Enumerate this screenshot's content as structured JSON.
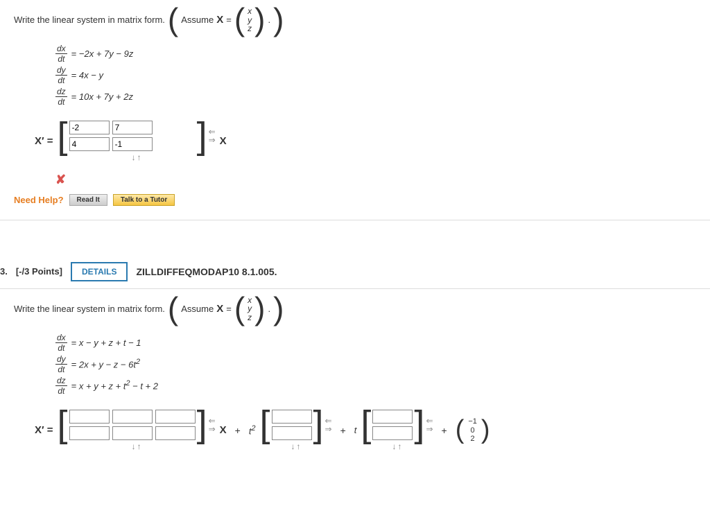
{
  "q2": {
    "prompt_a": "Write the linear system in matrix form.",
    "assume_label": "Assume",
    "assume_var": "X",
    "equals": "=",
    "vec": {
      "r1": "x",
      "r2": "y",
      "r3": "z"
    },
    "period": ".",
    "eqs": {
      "e1": {
        "lhs_num": "dx",
        "lhs_den": "dt",
        "eq": "=",
        "rhs": "−2x + 7y − 9z"
      },
      "e2": {
        "lhs_num": "dy",
        "lhs_den": "dt",
        "eq": "=",
        "rhs": "4x − y"
      },
      "e3": {
        "lhs_num": "dz",
        "lhs_den": "dt",
        "eq": "=",
        "rhs": "10x + 7y + 2z"
      }
    },
    "xprime": "X′",
    "matrix": {
      "r1c1": "-2",
      "r1c2": "7",
      "r1c3": "",
      "r2c1": "4",
      "r2c2": "-1",
      "r2c3": "",
      "r3c1": "",
      "r3c2": "",
      "r3c3": ""
    },
    "rhs_var": "X",
    "wrong": "✘",
    "need_help": "Need Help?",
    "read_it": "Read It",
    "talk": "Talk to a Tutor"
  },
  "q3": {
    "number": "3.",
    "points": "[-/3 Points]",
    "details": "DETAILS",
    "ref": "ZILLDIFFEQMODAP10 8.1.005.",
    "prompt_a": "Write the linear system in matrix form.",
    "assume_label": "Assume",
    "assume_var": "X",
    "equals": "=",
    "vec": {
      "r1": "x",
      "r2": "y",
      "r3": "z"
    },
    "period": ".",
    "eqs": {
      "e1": {
        "lhs_num": "dx",
        "lhs_den": "dt",
        "eq": "=",
        "rhs": "x − y + z + t − 1"
      },
      "e2": {
        "lhs_num": "dy",
        "lhs_den": "dt",
        "eq": "=",
        "rhs_a": "2x + y − z − 6t",
        "rhs_exp": "2"
      },
      "e3": {
        "lhs_num": "dz",
        "lhs_den": "dt",
        "eq": "=",
        "rhs_a": "x + y + z + t",
        "rhs_exp": "2",
        "rhs_b": " − t + 2"
      }
    },
    "xprime": "X′",
    "rhs_var": "X",
    "plus": "+",
    "t2_a": "t",
    "t2_exp": "2",
    "t1": "t",
    "const_vec": {
      "r1": "−1",
      "r2": "0",
      "r3": "2"
    }
  },
  "arrows": {
    "left": "⇐",
    "right": "⇒",
    "down": "↓",
    "up": "↑"
  }
}
